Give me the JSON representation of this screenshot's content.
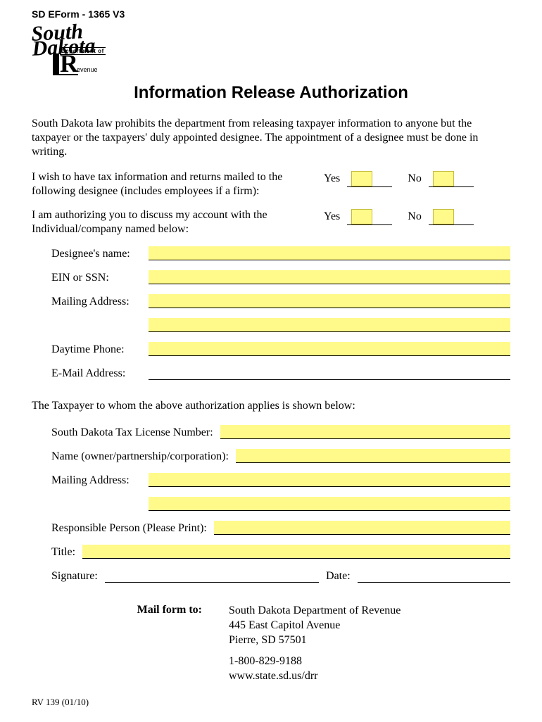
{
  "header": {
    "form_id": "SD EForm -    1365    V3",
    "logo_script": "South Dakota",
    "logo_dept": "Department of",
    "logo_r": "R",
    "logo_evenue": "evenue"
  },
  "title": "Information Release Authorization",
  "intro": "South Dakota law prohibits the department from releasing taxpayer information to anyone but the taxpayer or the taxpayers' duly appointed designee.  The appointment of a designee must be done in writing.",
  "question1": "I wish to have tax information and returns mailed to the following designee (includes employees if a firm):",
  "question2": "I am authorizing you to discuss my account with the Individual/company named below:",
  "yes_label": "Yes",
  "no_label": "No",
  "designee": {
    "name_label": "Designee's name:",
    "ein_label": "EIN or SSN:",
    "mailing_label": "Mailing Address:",
    "phone_label": "Daytime Phone:",
    "email_label": "E-Mail Address:"
  },
  "taxpayer_intro": "The Taxpayer to whom the above authorization applies is shown below:",
  "taxpayer": {
    "license_label": "South Dakota Tax License Number:",
    "name_label": "Name (owner/partnership/corporation):",
    "mailing_label": "Mailing Address:",
    "responsible_label": "Responsible Person (Please Print):",
    "title_label": "Title:",
    "signature_label": "Signature:",
    "date_label": "Date:"
  },
  "mail": {
    "label": "Mail form to:",
    "line1": "South Dakota Department of Revenue",
    "line2": "445 East Capitol Avenue",
    "line3": "Pierre, SD 57501",
    "phone": "1-800-829-9188",
    "web": "www.state.sd.us/drr"
  },
  "footer_id": "RV 139 (01/10)"
}
